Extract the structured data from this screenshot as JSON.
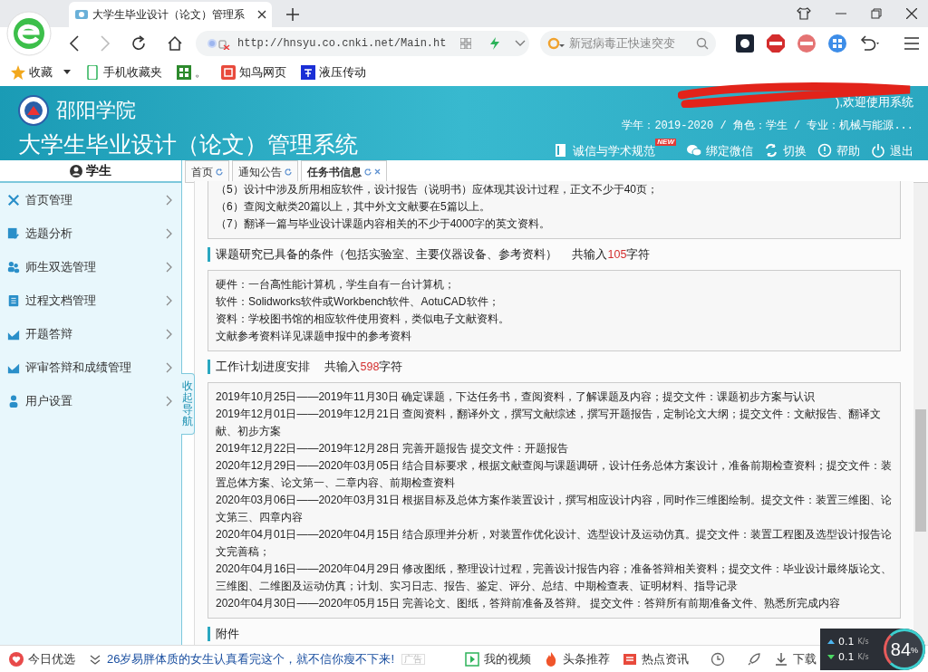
{
  "browser": {
    "tab_title": "大学生毕业设计（论文）管理系",
    "url": "http://hnsyu.co.cnki.net/Main.ht",
    "search_placeholder": "新冠病毒正快速突变",
    "bookmarks": [
      {
        "label": "收藏",
        "kind": "star"
      },
      {
        "label": "手机收藏夹",
        "kind": "phone"
      },
      {
        "label": "。",
        "kind": "grid"
      },
      {
        "label": "知鸟网页",
        "kind": "red"
      },
      {
        "label": "液压传动",
        "kind": "blue"
      }
    ]
  },
  "header": {
    "school": "邵阳学院",
    "system_title": "大学生毕业设计（论文）管理系统",
    "welcome": "),欢迎使用系统",
    "info": "学年：2019-2020 / 角色：学生 / 专业：机械与能源...",
    "links": [
      {
        "label": "诚信与学术规范",
        "kind": "book",
        "badge": "NEW"
      },
      {
        "label": "绑定微信",
        "kind": "wechat"
      },
      {
        "label": "切换",
        "kind": "switch"
      },
      {
        "label": "帮助",
        "kind": "help"
      },
      {
        "label": "退出",
        "kind": "power"
      }
    ]
  },
  "sidebar": {
    "title": "学生",
    "collapse_label": "收起导航",
    "items": [
      {
        "label": "首页管理",
        "kind": "tools"
      },
      {
        "label": "选题分析",
        "kind": "doc"
      },
      {
        "label": "师生双选管理",
        "kind": "people"
      },
      {
        "label": "过程文档管理",
        "kind": "file"
      },
      {
        "label": "开题答辩",
        "kind": "chart"
      },
      {
        "label": "评审答辩和成绩管理",
        "kind": "chart"
      },
      {
        "label": "用户设置",
        "kind": "user"
      }
    ]
  },
  "tabs": [
    {
      "label": "首页",
      "selected": false,
      "closable": false
    },
    {
      "label": "通知公告",
      "selected": false,
      "closable": false
    },
    {
      "label": "任务书信息",
      "selected": true,
      "closable": true
    }
  ],
  "sections": [
    {
      "lines": [
        "（5）设计中涉及所用相应软件，设计报告（说明书）应体现其设计过程，正文不少于40页；",
        "（6）查阅文献类20篇以上，其中外文文献要在5篇以上。",
        "（7）翻译一篇与毕业设计课题内容相关的不少于4000字的英文资料。"
      ]
    },
    {
      "heading": "课题研究已具备的条件（包括实验室、主要仪器设备、参考资料）",
      "count_prefix": "共输入",
      "count": "105",
      "count_suffix": "字符",
      "lines": [
        "硬件：一台高性能计算机，学生自有一台计算机；",
        "软件：Solidworks软件或Workbench软件、AotuCAD软件；",
        "资料：学校图书馆的相应软件使用资料，类似电子文献资料。",
        "文献参考资料详见课题申报中的参考资料"
      ]
    },
    {
      "heading": "工作计划进度安排",
      "count_prefix": "共输入",
      "count": "598",
      "count_suffix": "字符",
      "lines": [
        "2019年10月25日——2019年11月30日 确定课题，下达任务书，查阅资料，了解课题及内容；提交文件：课题初步方案与认识",
        "2019年12月01日——2019年12月21日 查阅资料，翻译外文，撰写文献综述，撰写开题报告，定制论文大纲；提交文件：文献报告、翻译文献、初步方案",
        "2019年12月22日——2019年12月28日 完善开题报告 提交文件：开题报告",
        "2020年12月29日——2020年03月05日 结合目标要求，根据文献查阅与课题调研，设计任务总体方案设计，准备前期检查资料；提交文件：装置总体方案、论文第一、二章内容、前期检查资料",
        "2020年03月06日——2020年03月31日 根据目标及总体方案作装置设计，撰写相应设计内容，同时作三维图绘制。提交文件：装置三维图、论文第三、四章内容",
        "2020年04月01日——2020年04月15日 结合原理并分析，对装置作优化设计、选型设计及运动仿真。提交文件：装置工程图及选型设计报告论文完善稿；",
        "2020年04月16日——2020年04月29日 修改图纸，整理设计过程，完善设计报告内容；准备答辩相关资料；提交文件：毕业设计最终版论文、三维图、二维图及运动仿真；计划、实习日志、报告、鉴定、评分、总结、中期检查表、证明材料、指导记录",
        "2020年04月30日——2020年05月15日 完善论文、图纸，答辩前准备及答辩。 提交文件：答辩所有前期准备文件、熟悉所完成内容"
      ]
    },
    {
      "heading": "附件"
    }
  ],
  "status_bar": {
    "items": [
      {
        "label": "今日优选",
        "kind": "heart"
      },
      {
        "label": "26岁易胖体质的女生认真看完这个，就不信你瘦不下来!",
        "kind": "news"
      },
      {
        "label": "广告",
        "kind": "ad"
      },
      {
        "label": "我的视频",
        "kind": "play"
      },
      {
        "label": "头条推荐",
        "kind": "fire"
      },
      {
        "label": "热点资讯",
        "kind": "hot"
      },
      {
        "label": "下载",
        "kind": "download"
      }
    ]
  },
  "speed_widget": {
    "up": "0.1",
    "down": "0.1",
    "up_unit": "K/s",
    "down_unit": "K/s",
    "percent": "84",
    "percent_sign": "%"
  }
}
